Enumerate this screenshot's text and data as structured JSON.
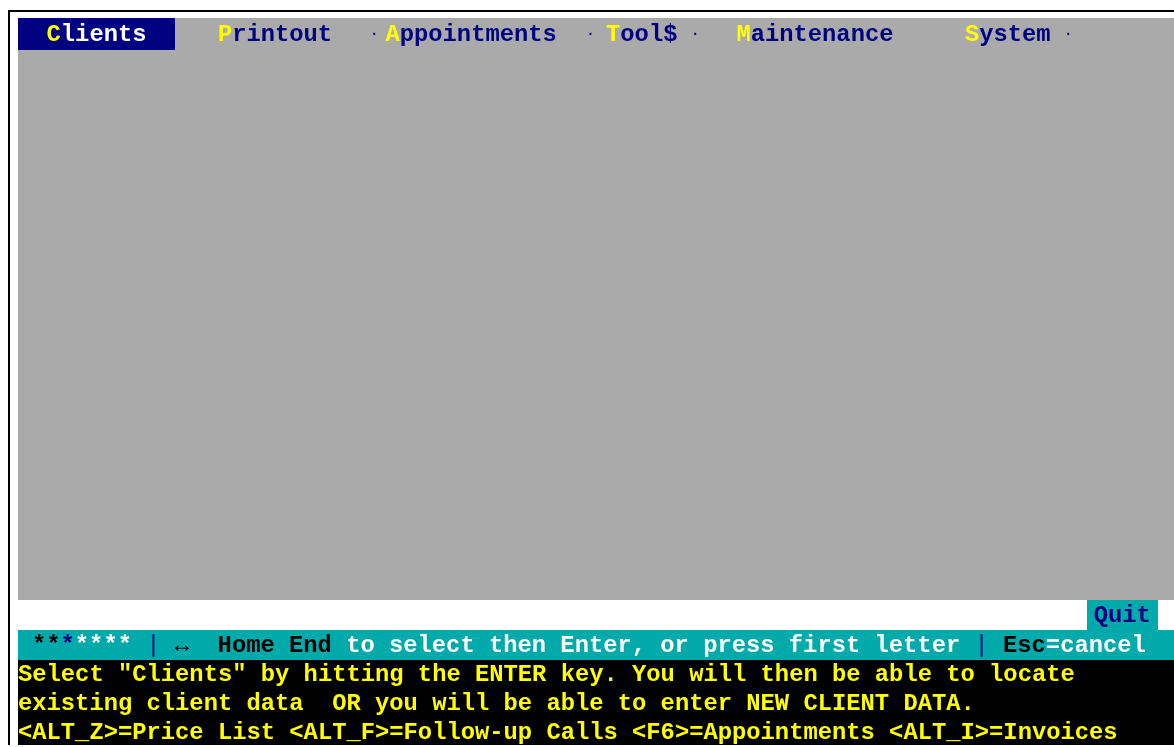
{
  "menu": [
    {
      "kind": "item",
      "hotkey": "C",
      "rest": "lients",
      "selected": true
    },
    {
      "kind": "item",
      "hotkey": "P",
      "rest": "rintout",
      "selected": false
    },
    {
      "kind": "separator",
      "text": "·"
    },
    {
      "kind": "item",
      "hotkey": "A",
      "rest": "ppointments",
      "selected": false
    },
    {
      "kind": "separator",
      "text": "·"
    },
    {
      "kind": "item",
      "hotkey": "T",
      "rest": "ool$",
      "selected": false
    },
    {
      "kind": "separator",
      "text": "·"
    },
    {
      "kind": "item",
      "hotkey": "M",
      "rest": "aintenance",
      "selected": false
    },
    {
      "kind": "item",
      "hotkey": "S",
      "rest": "ystem",
      "selected": false
    },
    {
      "kind": "separator",
      "text": "·"
    }
  ],
  "quit_button": "Quit",
  "status_bar": [
    {
      "kind": "key",
      "text": "**"
    },
    {
      "kind": "marker",
      "text": "*"
    },
    {
      "kind": "hint",
      "text": "****"
    },
    {
      "kind": "divider",
      "text": "|"
    },
    {
      "kind": "key",
      "text": "↔  Home End"
    },
    {
      "kind": "hint",
      "text": "to select then Enter, or press first letter"
    },
    {
      "kind": "divider",
      "text": "|"
    },
    {
      "kind": "key",
      "text": "Esc"
    },
    {
      "kind": "hint",
      "text": "=cancel"
    }
  ],
  "help_lines": [
    "Select \"Clients\" by hitting the ENTER key. You will then be able to locate",
    "existing client data  OR you will be able to enter NEW CLIENT DATA.",
    "<ALT_Z>=Price List <ALT_F>=Follow-up Calls <F6>=Appointments <ALT_I>=Invoices"
  ]
}
